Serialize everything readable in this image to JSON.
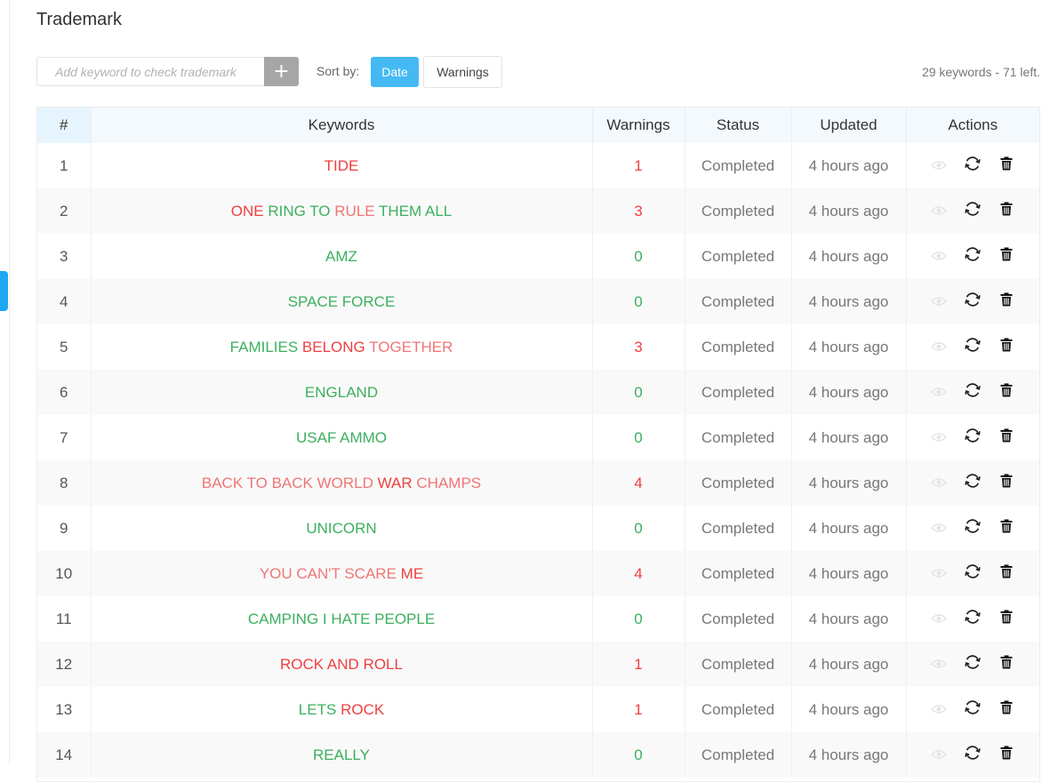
{
  "page": {
    "title": "Trademark"
  },
  "toolbar": {
    "input_placeholder": "Add keyword to check trademark",
    "add_label": "+",
    "sort_label": "Sort by:",
    "sort_date": "Date",
    "sort_warnings": "Warnings",
    "count": "29 keywords - 71 left."
  },
  "colors": {
    "accent": "#44b9f3",
    "ok": "#3cb05e",
    "warn": "#ee4040",
    "warn_light": "#f07575"
  },
  "table": {
    "headers": [
      "#",
      "Keywords",
      "Warnings",
      "Status",
      "Updated",
      "Actions"
    ],
    "action_icons": [
      "eye-icon",
      "refresh-icon",
      "trash-icon"
    ],
    "rows": [
      {
        "num": "1",
        "words": [
          [
            "TIDE",
            "bad"
          ]
        ],
        "warnings": "1",
        "status": "Completed",
        "updated": "4 hours ago"
      },
      {
        "num": "2",
        "words": [
          [
            "ONE",
            "bad"
          ],
          [
            "RING TO",
            "ok"
          ],
          [
            "RULE",
            "mid"
          ],
          [
            "THEM ALL",
            "ok"
          ]
        ],
        "warnings": "3",
        "status": "Completed",
        "updated": "4 hours ago"
      },
      {
        "num": "3",
        "words": [
          [
            "AMZ",
            "ok"
          ]
        ],
        "warnings": "0",
        "status": "Completed",
        "updated": "4 hours ago"
      },
      {
        "num": "4",
        "words": [
          [
            "SPACE FORCE",
            "ok"
          ]
        ],
        "warnings": "0",
        "status": "Completed",
        "updated": "4 hours ago"
      },
      {
        "num": "5",
        "words": [
          [
            "FAMILIES",
            "ok"
          ],
          [
            "BELONG",
            "bad"
          ],
          [
            "TOGETHER",
            "mid"
          ]
        ],
        "warnings": "3",
        "status": "Completed",
        "updated": "4 hours ago"
      },
      {
        "num": "6",
        "words": [
          [
            "ENGLAND",
            "ok"
          ]
        ],
        "warnings": "0",
        "status": "Completed",
        "updated": "4 hours ago"
      },
      {
        "num": "7",
        "words": [
          [
            "USAF AMMO",
            "ok"
          ]
        ],
        "warnings": "0",
        "status": "Completed",
        "updated": "4 hours ago"
      },
      {
        "num": "8",
        "words": [
          [
            "BACK TO BACK",
            "mid"
          ],
          [
            "WORLD",
            "mid"
          ],
          [
            "WAR",
            "bad"
          ],
          [
            "CHAMPS",
            "mid"
          ]
        ],
        "warnings": "4",
        "status": "Completed",
        "updated": "4 hours ago"
      },
      {
        "num": "9",
        "words": [
          [
            "UNICORN",
            "ok"
          ]
        ],
        "warnings": "0",
        "status": "Completed",
        "updated": "4 hours ago"
      },
      {
        "num": "10",
        "words": [
          [
            "YOU CAN'T SCARE",
            "mid"
          ],
          [
            "ME",
            "bad"
          ]
        ],
        "warnings": "4",
        "status": "Completed",
        "updated": "4 hours ago"
      },
      {
        "num": "11",
        "words": [
          [
            "CAMPING I HATE PEOPLE",
            "ok"
          ]
        ],
        "warnings": "0",
        "status": "Completed",
        "updated": "4 hours ago"
      },
      {
        "num": "12",
        "words": [
          [
            "ROCK AND ROLL",
            "bad"
          ]
        ],
        "warnings": "1",
        "status": "Completed",
        "updated": "4 hours ago"
      },
      {
        "num": "13",
        "words": [
          [
            "LETS",
            "ok"
          ],
          [
            "ROCK",
            "bad"
          ]
        ],
        "warnings": "1",
        "status": "Completed",
        "updated": "4 hours ago"
      },
      {
        "num": "14",
        "words": [
          [
            "REALLY",
            "ok"
          ]
        ],
        "warnings": "0",
        "status": "Completed",
        "updated": "4 hours ago"
      }
    ]
  }
}
